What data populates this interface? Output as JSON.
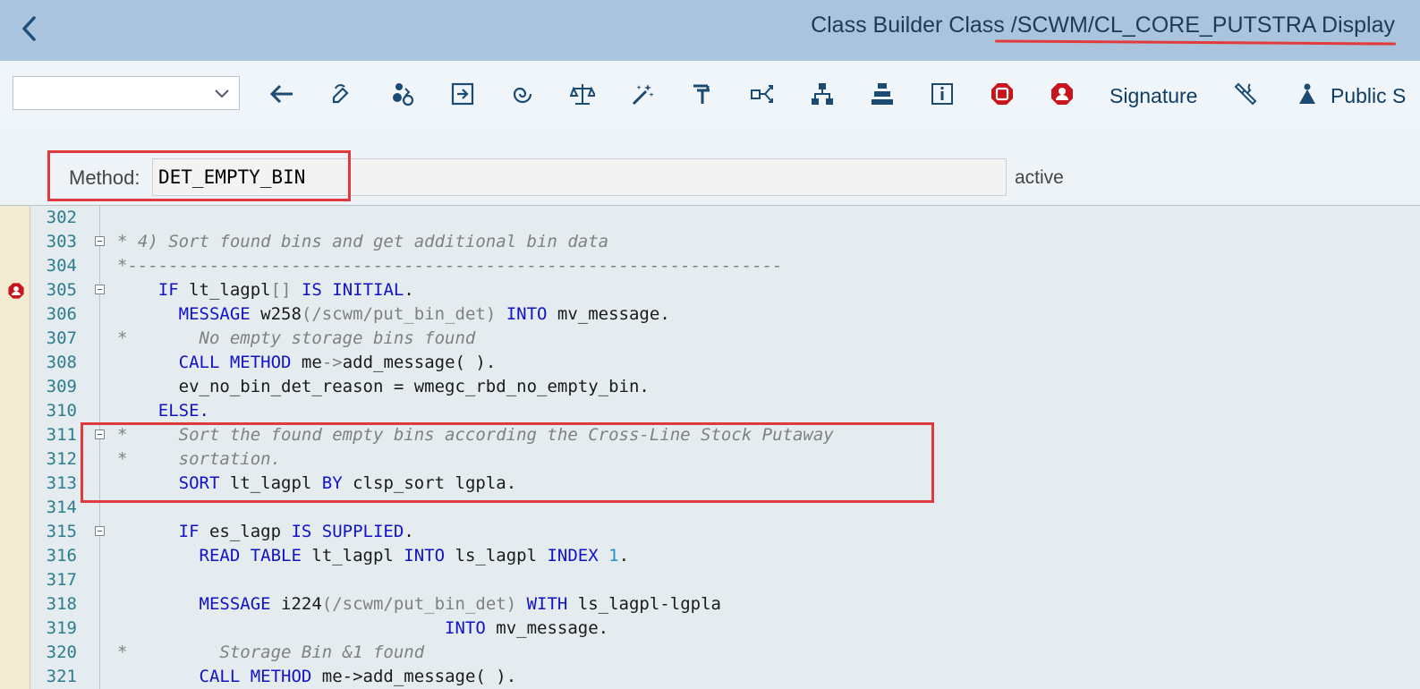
{
  "window": {
    "title": "Class Builder Class /SCWM/CL_CORE_PUTSTRA Display"
  },
  "toolbar": {
    "dropdown_value": "",
    "icons": [
      "back-arrow-icon",
      "display-change-icon",
      "activate-icon",
      "check-icon",
      "where-used-icon",
      "compare-icon",
      "pretty-printer-icon",
      "debug-icon",
      "navigate-icon",
      "hierarchy-icon",
      "structure-icon",
      "info-icon",
      "stop-breakpoint-icon",
      "user-breakpoint-icon",
      "signature-icon",
      "settings-icon",
      "public-section-icon"
    ],
    "signature_label": "Signature",
    "public_label": "Public S"
  },
  "method": {
    "label": "Method:",
    "value": "DET_EMPTY_BIN",
    "status": "active"
  },
  "code_lines": [
    {
      "n": "302"
    },
    {
      "n": "303"
    },
    {
      "n": "304"
    },
    {
      "n": "305"
    },
    {
      "n": "306"
    },
    {
      "n": "307"
    },
    {
      "n": "308"
    },
    {
      "n": "309"
    },
    {
      "n": "310"
    },
    {
      "n": "311"
    },
    {
      "n": "312"
    },
    {
      "n": "313"
    },
    {
      "n": "314"
    },
    {
      "n": "315"
    },
    {
      "n": "316"
    },
    {
      "n": "317"
    },
    {
      "n": "318"
    },
    {
      "n": "319"
    },
    {
      "n": "320"
    },
    {
      "n": "321"
    }
  ],
  "code": {
    "l303": "* 4) Sort found bins and get additional bin data",
    "l304": "*----------------------------------------------------------------",
    "l305a": "IF",
    "l305b": " lt_lagpl",
    "l305c": "[]",
    "l305d": "IS INITIAL",
    "l305e": ".",
    "l306a": "MESSAGE",
    "l306b": " w258",
    "l306c": "(/scwm/put_bin_det)",
    "l306d": "INTO",
    "l306e": " mv_message.",
    "l307": "*       No empty storage bins found",
    "l308a": "CALL METHOD",
    "l308b": " me",
    "l308c": "->",
    "l308d": "add_message",
    "l308e": "( ).",
    "l309": "ev_no_bin_det_reason = wmegc_rbd_no_empty_bin.",
    "l310": "ELSE.",
    "l311": "*     Sort the found empty bins according the Cross-Line Stock Putaway",
    "l312": "*     sortation.",
    "l313a": "SORT",
    "l313b": " lt_lagpl ",
    "l313c": "BY",
    "l313d": " clsp_sort lgpla.",
    "l315a": "IF",
    "l315b": " es_lagp ",
    "l315c": "IS SUPPLIED",
    "l315d": ".",
    "l316a": "READ TABLE",
    "l316b": " lt_lagpl ",
    "l316c": "INTO",
    "l316d": " ls_lagpl ",
    "l316e": "INDEX",
    "l316f": "1",
    "l316g": ".",
    "l318a": "MESSAGE",
    "l318b": " i224",
    "l318c": "(/scwm/put_bin_det)",
    "l318d": "WITH",
    "l318e": " ls_lagpl-lgpla",
    "l319a": "INTO",
    "l319b": " mv_message.",
    "l320": "*         Storage Bin &1 found",
    "l321a": "CALL METHOD",
    "l321b": " me->add_message( )."
  }
}
